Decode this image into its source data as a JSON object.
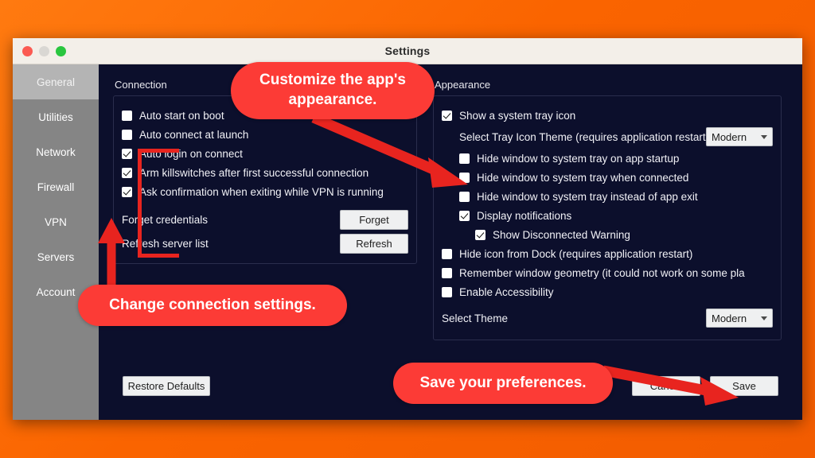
{
  "window": {
    "title": "Settings",
    "traffic_lights": [
      "close",
      "minimize",
      "zoom"
    ]
  },
  "sidebar": {
    "items": [
      {
        "label": "General",
        "active": true
      },
      {
        "label": "Utilities",
        "active": false
      },
      {
        "label": "Network",
        "active": false
      },
      {
        "label": "Firewall",
        "active": false
      },
      {
        "label": "VPN",
        "active": false
      },
      {
        "label": "Servers",
        "active": false
      },
      {
        "label": "Account",
        "active": false
      }
    ]
  },
  "connection": {
    "group_title": "Connection",
    "checkboxes": [
      {
        "label": "Auto start on boot",
        "checked": false
      },
      {
        "label": "Auto connect at launch",
        "checked": false
      },
      {
        "label": "Auto login on connect",
        "checked": true
      },
      {
        "label": "Arm killswitches after first successful connection",
        "checked": true
      },
      {
        "label": "Ask confirmation when exiting while VPN is running",
        "checked": true
      }
    ],
    "forget_credentials_label": "Forget credentials",
    "forget_button": "Forget",
    "refresh_server_list_label": "Refresh server list",
    "refresh_button": "Refresh"
  },
  "appearance": {
    "group_title": "Appearance",
    "show_tray_icon": {
      "label": "Show a system tray icon",
      "checked": true
    },
    "tray_icon_theme": {
      "label": "Select Tray Icon Theme (requires application restart)",
      "value": "Modern"
    },
    "checkboxes": [
      {
        "label": "Hide window to system tray on app startup",
        "checked": false
      },
      {
        "label": "Hide window to system tray when connected",
        "checked": false
      },
      {
        "label": "Hide window to system tray instead of app exit",
        "checked": false
      },
      {
        "label": "Display notifications",
        "checked": true
      }
    ],
    "show_disconnected_warning": {
      "label": "Show Disconnected Warning",
      "checked": true
    },
    "bottom_checkboxes": [
      {
        "label": "Hide icon from Dock (requires application restart)",
        "checked": false
      },
      {
        "label": "Remember window geometry (it could not work on some pla",
        "checked": false
      },
      {
        "label": "Enable Accessibility",
        "checked": false
      }
    ],
    "select_theme": {
      "label": "Select Theme",
      "value": "Modern"
    }
  },
  "footer": {
    "restore_defaults": "Restore Defaults",
    "cancel": "Cancel",
    "save": "Save"
  },
  "annotations": {
    "appearance_callout": "Customize the app's appearance.",
    "connection_callout": "Change connection settings.",
    "save_callout": "Save your preferences."
  },
  "colors": {
    "accent_red": "#fc3b36",
    "highlight_red": "#e8241f",
    "background_orange": "#fa6400",
    "window_dark": "#0c0f2c",
    "sidebar_grey": "#858585",
    "sidebar_active_grey": "#b4b4b4"
  }
}
